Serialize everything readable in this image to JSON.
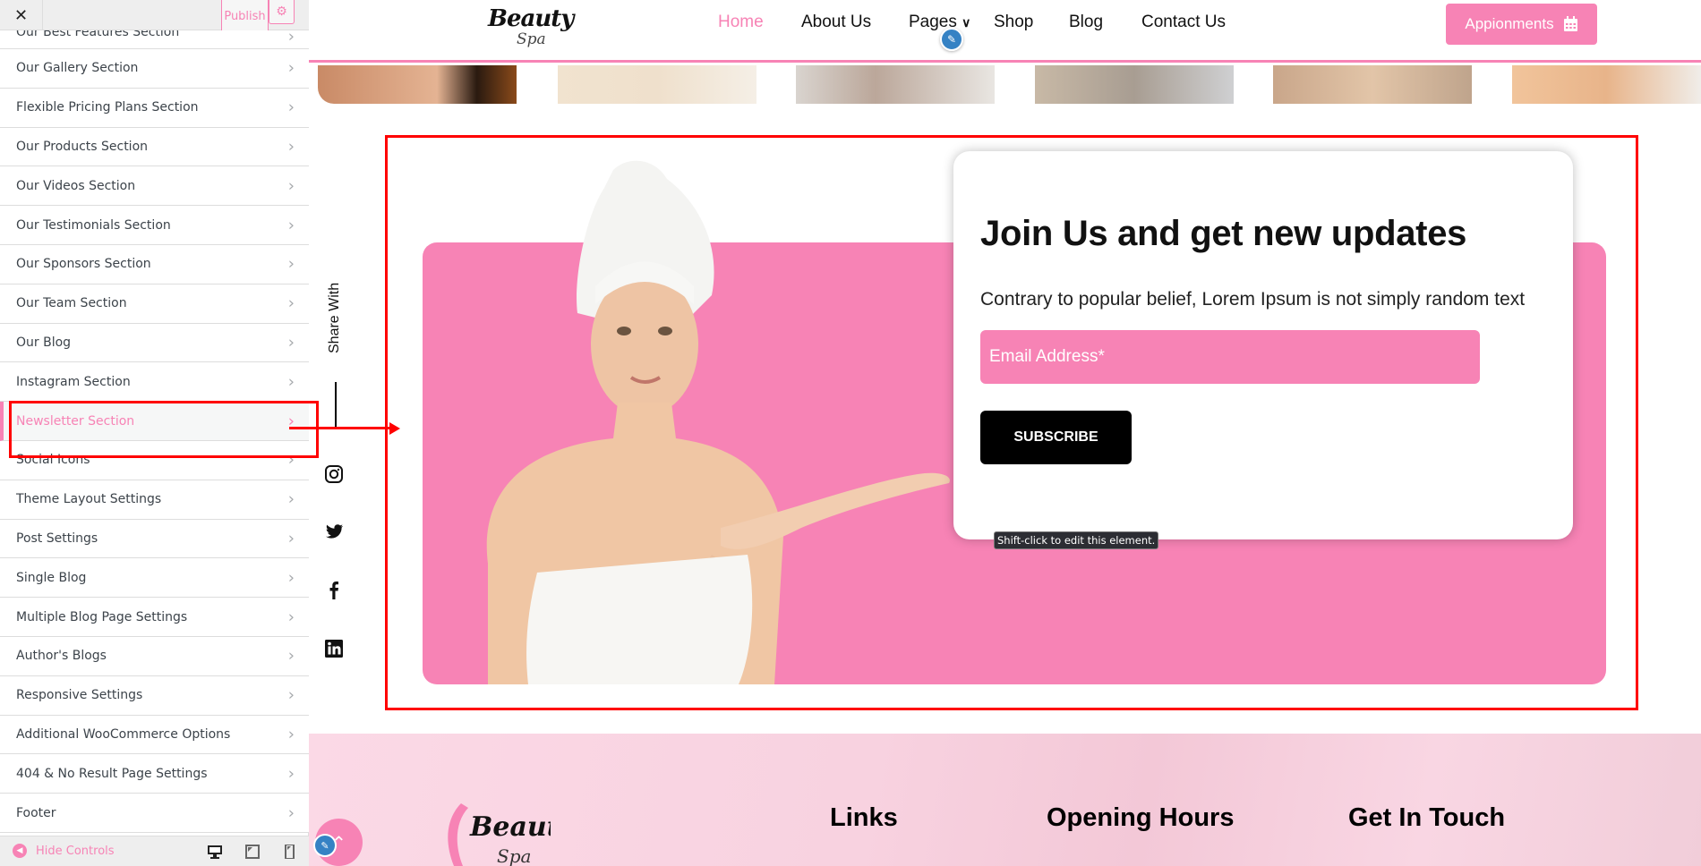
{
  "customizer": {
    "close_label": "✕",
    "publish_label": "Publish",
    "settings_icon": "⚙",
    "items": [
      {
        "label": "Our Best Features Section"
      },
      {
        "label": "Our Gallery Section"
      },
      {
        "label": "Flexible Pricing Plans Section"
      },
      {
        "label": "Our Products Section"
      },
      {
        "label": "Our Videos Section"
      },
      {
        "label": "Our Testimonials Section"
      },
      {
        "label": "Our Sponsors Section"
      },
      {
        "label": "Our Team Section"
      },
      {
        "label": "Our Blog"
      },
      {
        "label": "Instagram Section"
      },
      {
        "label": "Newsletter Section",
        "active": true
      },
      {
        "label": "Social Icons"
      },
      {
        "label": "Theme Layout Settings"
      },
      {
        "label": "Post Settings"
      },
      {
        "label": "Single Blog"
      },
      {
        "label": "Multiple Blog Page Settings"
      },
      {
        "label": "Author's Blogs"
      },
      {
        "label": "Responsive Settings"
      },
      {
        "label": "Additional WooCommerce Options"
      },
      {
        "label": "404 & No Result Page Settings"
      },
      {
        "label": "Footer"
      }
    ],
    "chevron": "›",
    "hide_controls_label": "Hide Controls",
    "devices": [
      "desktop",
      "tablet",
      "mobile"
    ],
    "accent_color": "#f783b5"
  },
  "site": {
    "logo_line1": "Beauty",
    "logo_line2": "Spa",
    "nav": [
      {
        "label": "Home",
        "active": true
      },
      {
        "label": "About Us"
      },
      {
        "label": "Pages",
        "has_dropdown": true
      },
      {
        "label": "Shop"
      },
      {
        "label": "Blog"
      },
      {
        "label": "Contact Us"
      }
    ],
    "dropdown_icon": "⌄",
    "appointment_label": "Appionments",
    "brand_color": "#f783b5"
  },
  "newsletter": {
    "title": "Join Us and get new updates",
    "description": "Contrary to popular belief, Lorem Ipsum is not simply random text",
    "email_placeholder": "Email Address*",
    "email_value": "",
    "subscribe_label": "SUBSCRIBE",
    "tooltip": "Shift-click to edit this element."
  },
  "share": {
    "label": "Share With",
    "icons": [
      "instagram-icon",
      "twitter-icon",
      "facebook-icon",
      "linkedin-icon"
    ]
  },
  "footer": {
    "logo_line1": "Beauty",
    "logo_line2": "Spa",
    "headings": [
      "Links",
      "Opening Hours",
      "Get In Touch"
    ]
  }
}
